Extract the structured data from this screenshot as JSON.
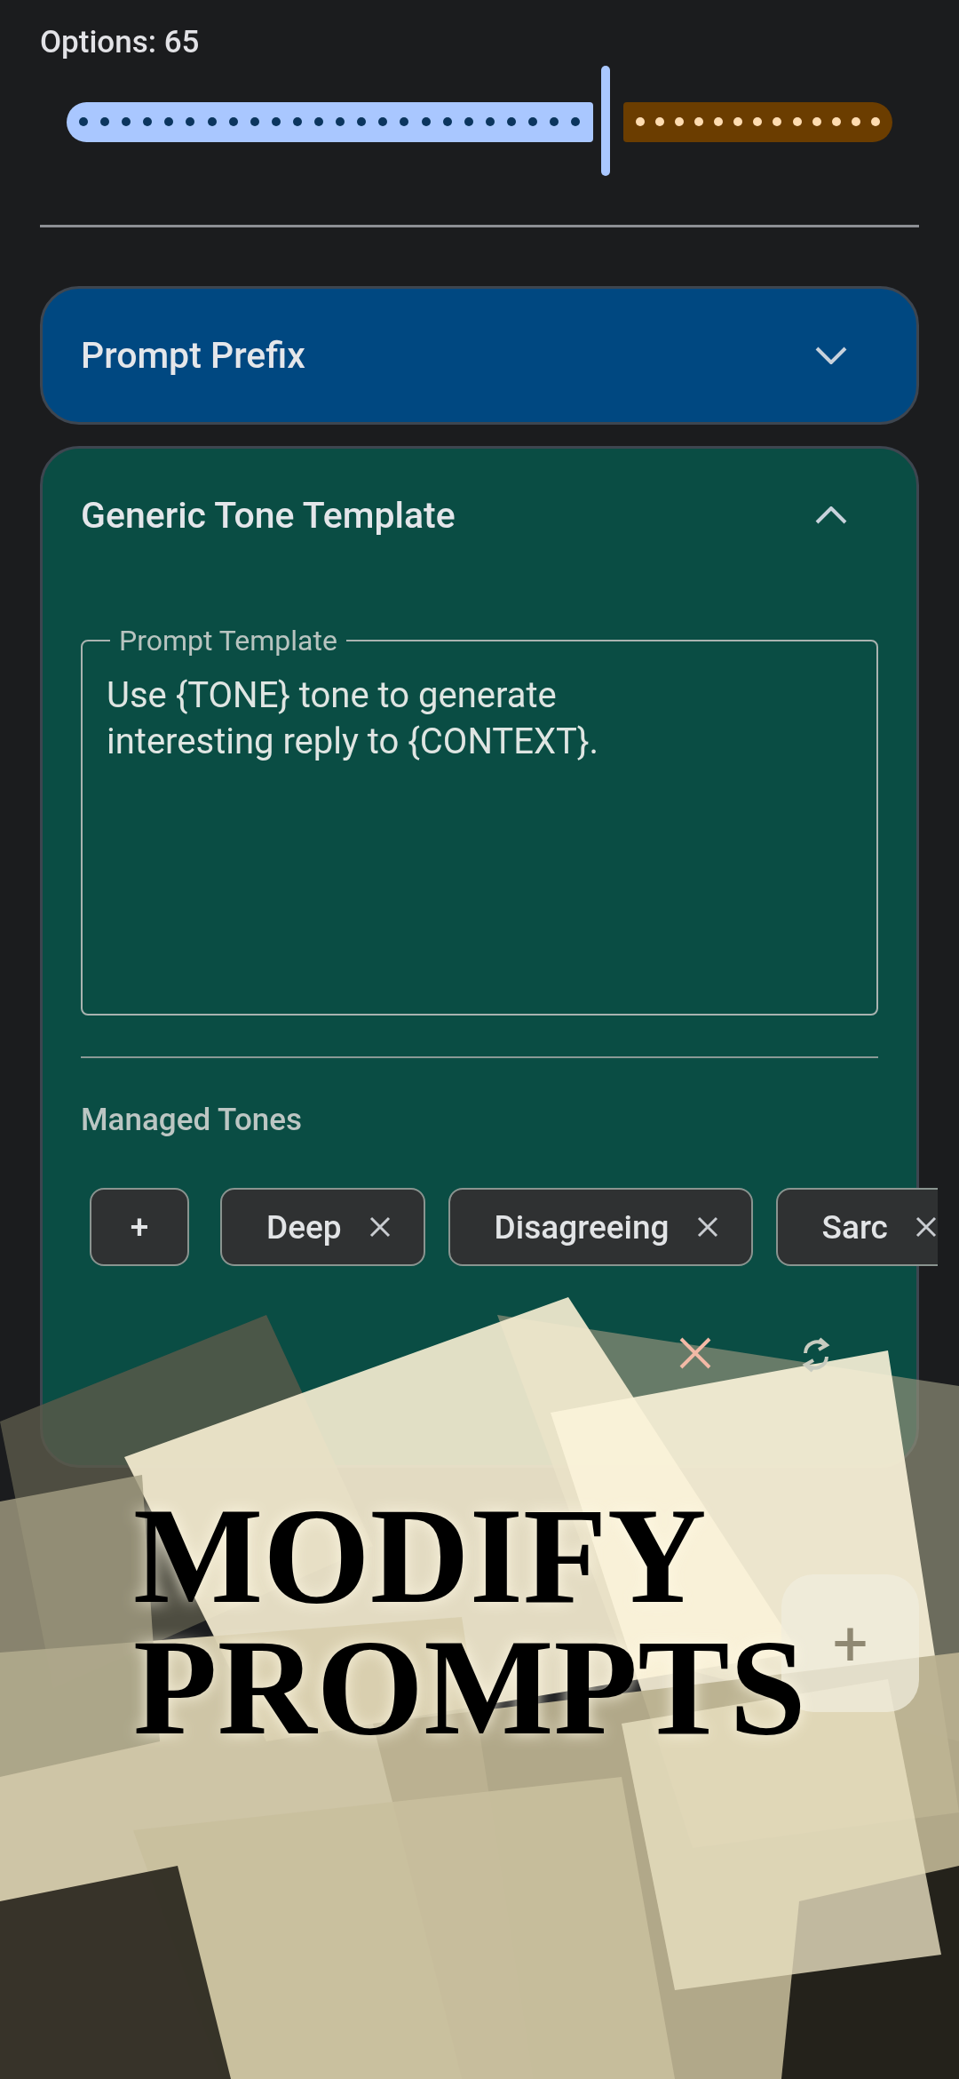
{
  "options": {
    "label": "Options: 65",
    "level": 0.65
  },
  "sections": [
    {
      "title": "Prompt Prefix",
      "expanded": false
    },
    {
      "title": "Generic Tone Template",
      "expanded": true,
      "field": {
        "label": "Prompt Template",
        "value": "Use {TONE} tone to generate interesting reply to {CONTEXT}."
      },
      "tones_title": "Managed Tones",
      "chips": [
        {
          "kind": "add",
          "label": "+"
        },
        {
          "kind": "tone",
          "label": "Deep"
        },
        {
          "kind": "tone",
          "label": "Disagreeing"
        },
        {
          "kind": "tone",
          "label": "Sarc"
        }
      ]
    }
  ],
  "fab": {
    "label": "+"
  },
  "headline": [
    "MODIFY",
    "PROMPTS"
  ]
}
